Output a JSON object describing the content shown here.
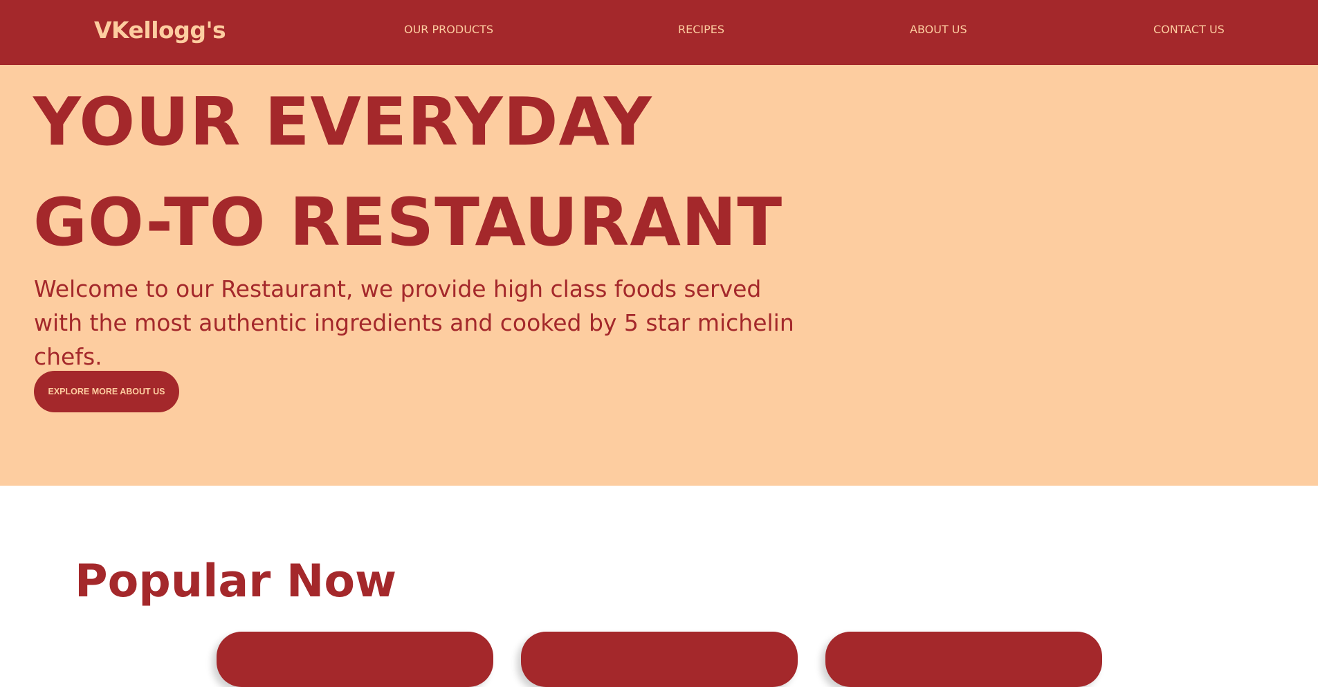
{
  "navbar": {
    "brand": "VKellogg's",
    "links": [
      {
        "label": "OUR PRODUCTS"
      },
      {
        "label": "RECIPES"
      },
      {
        "label": "ABOUT US"
      },
      {
        "label": "CONTACT US"
      }
    ]
  },
  "hero": {
    "heading_lines": [
      "YOUR EVERYDAY",
      "GO-TO RESTAURANT"
    ],
    "description": "Welcome to our Restaurant, we provide high class foods served with the most authentic ingredients and cooked by 5 star michelin chefs.",
    "cta_label": "EXPLORE MORE ABOUT US"
  },
  "popular": {
    "title": "Popular Now"
  },
  "colors": {
    "primary": "#a4282b",
    "accent": "#fdcda0",
    "background": "#ffffff"
  }
}
